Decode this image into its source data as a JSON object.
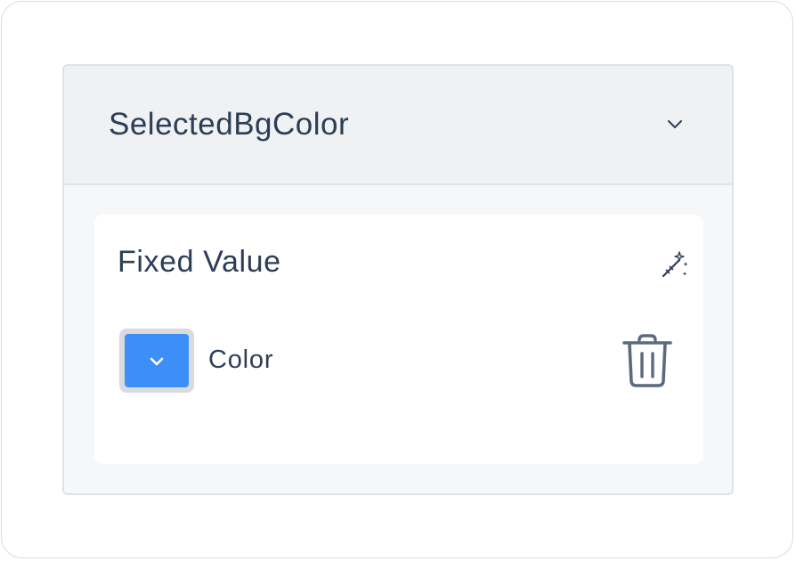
{
  "property_panel": {
    "title": "SelectedBgColor",
    "collapse_icon": "chevron-down-icon"
  },
  "value_card": {
    "label": "Fixed Value",
    "magic_icon": "magic-wand-icon",
    "color_row": {
      "swatch_color": "#3e8ef7",
      "swatch_icon": "chevron-down-icon",
      "label": "Color",
      "delete_icon": "trash-icon"
    }
  },
  "colors": {
    "text": "#2c3e56",
    "header_bg": "#f0f1f3",
    "panel_bg": "#f6f7f9",
    "card_bg": "#ffffff",
    "border": "#dfe2e6",
    "accent": "#3e8ef7"
  }
}
